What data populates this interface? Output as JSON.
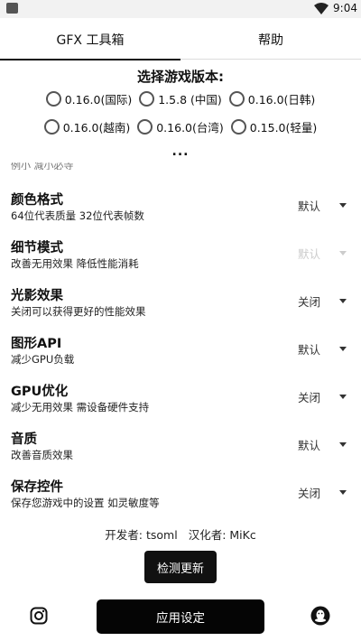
{
  "status_bar": {
    "time": "9:04",
    "icons": [
      "app-icon",
      "wifi-icon",
      "battery-icon"
    ]
  },
  "tabs": [
    {
      "label": "GFX 工具箱",
      "selected": true
    },
    {
      "label": "帮助",
      "selected": false
    }
  ],
  "version_picker": {
    "title": "选择游戏版本:",
    "options": [
      "0.16.0(国际)",
      "1.5.8 (中国)",
      "0.16.0(日韩)",
      "0.16.0(越南)",
      "0.16.0(台湾)",
      "0.15.0(轻量)"
    ],
    "more": "..."
  },
  "clipped_text": "例小 减小必寺",
  "settings": [
    {
      "title": "颜色格式",
      "desc": "64位代表质量 32位代表帧数",
      "value": "默认",
      "enabled": true
    },
    {
      "title": "细节模式",
      "desc": "改善无用效果 降低性能消耗",
      "value": "默认",
      "enabled": false
    },
    {
      "title": "光影效果",
      "desc": "关闭可以获得更好的性能效果",
      "value": "关闭",
      "enabled": true
    },
    {
      "title": "图形API",
      "desc": "减少GPU负载",
      "value": "默认",
      "enabled": true
    },
    {
      "title": "GPU优化",
      "desc": "减少无用效果 需设备硬件支持",
      "value": "关闭",
      "enabled": true
    },
    {
      "title": "音质",
      "desc": "改善音质效果",
      "value": "默认",
      "enabled": true
    },
    {
      "title": "保存控件",
      "desc": "保存您游戏中的设置 如灵敏度等",
      "value": "关闭",
      "enabled": true
    }
  ],
  "credits": {
    "developer": "开发者: tsoml",
    "translator": "汉化者: MiKc"
  },
  "buttons": {
    "check_update": "检测更新",
    "apply": "应用设定"
  },
  "colors": {
    "accent": "#111111",
    "disabled": "#cccccc",
    "background": "#ffffff"
  }
}
